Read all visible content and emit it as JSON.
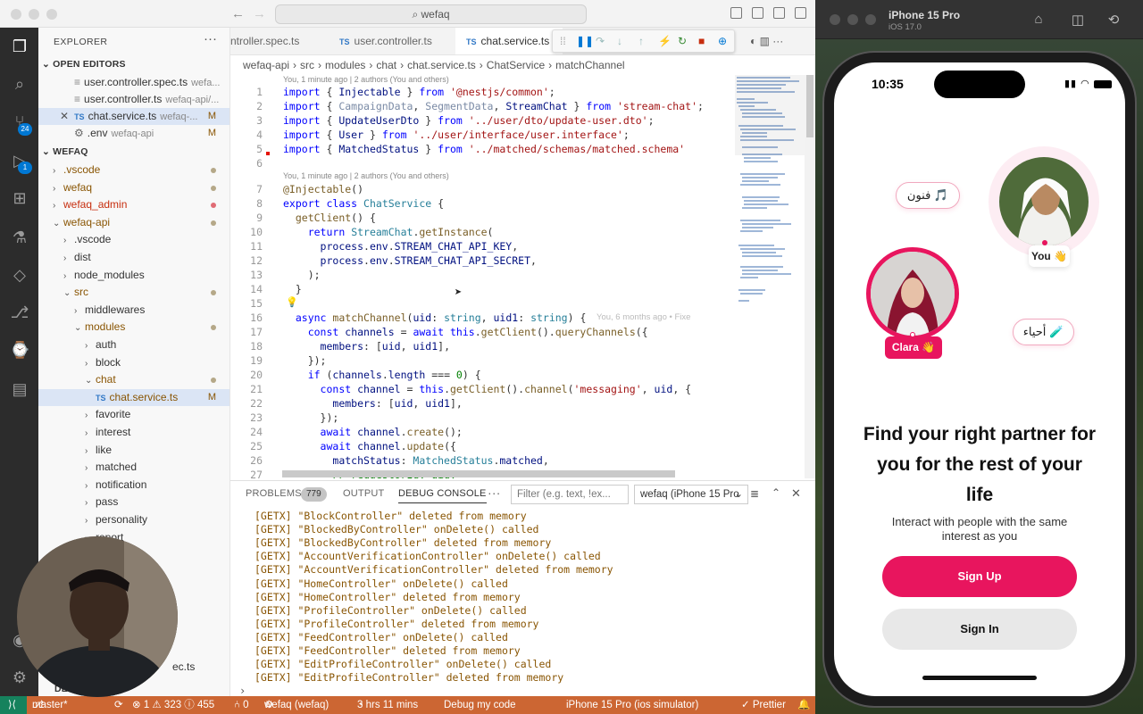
{
  "titlebar": {
    "search": "wefaq"
  },
  "activity": {
    "scm_badge": "24",
    "debug_badge": "1"
  },
  "explorer": {
    "title": "EXPLORER",
    "open_editors_label": "OPEN EDITORS",
    "open_editors": [
      {
        "name": "user.controller.spec.ts",
        "desc": "wefa...",
        "mod": ""
      },
      {
        "name": "user.controller.ts",
        "desc": "wefaq-api/...",
        "mod": ""
      },
      {
        "name": "chat.service.ts",
        "desc": "wefaq-...",
        "mod": "M"
      },
      {
        "name": ".env",
        "desc": "wefaq-api",
        "mod": "M"
      }
    ],
    "workspace_label": "WEFAQ",
    "tree": [
      {
        "name": ".vscode",
        "state": "›",
        "mod": "dot"
      },
      {
        "name": "wefaq",
        "state": "›",
        "mod": "dot"
      },
      {
        "name": "wefaq_admin",
        "state": "›",
        "mod": "red"
      },
      {
        "name": "wefaq-api",
        "state": "⌄",
        "mod": "dot"
      },
      {
        "name": ".vscode",
        "state": "›",
        "mod": ""
      },
      {
        "name": "dist",
        "state": "›",
        "mod": ""
      },
      {
        "name": "node_modules",
        "state": "›",
        "mod": ""
      },
      {
        "name": "src",
        "state": "⌄",
        "mod": "dot"
      },
      {
        "name": "middlewares",
        "state": "›",
        "mod": ""
      },
      {
        "name": "modules",
        "state": "⌄",
        "mod": "dot"
      },
      {
        "name": "auth",
        "state": "›",
        "mod": ""
      },
      {
        "name": "block",
        "state": "›",
        "mod": ""
      },
      {
        "name": "chat",
        "state": "⌄",
        "mod": "dot"
      },
      {
        "name": "chat.service.ts",
        "state": "TS",
        "mod": "M"
      },
      {
        "name": "favorite",
        "state": "›",
        "mod": ""
      },
      {
        "name": "interest",
        "state": "›",
        "mod": ""
      },
      {
        "name": "like",
        "state": "›",
        "mod": ""
      },
      {
        "name": "matched",
        "state": "›",
        "mod": ""
      },
      {
        "name": "notification",
        "state": "›",
        "mod": ""
      },
      {
        "name": "pass",
        "state": "›",
        "mod": ""
      },
      {
        "name": "personality",
        "state": "›",
        "mod": ""
      },
      {
        "name": "report",
        "state": "›",
        "mod": ""
      }
    ],
    "hidden_row": "ec.ts",
    "bottom_label": "DE"
  },
  "tabs": [
    {
      "label": "ntroller.spec.ts",
      "icon": ""
    },
    {
      "label": "user.controller.ts",
      "icon": "TS"
    },
    {
      "label": "chat.service.ts",
      "icon": "TS"
    }
  ],
  "breadcrumb": [
    "wefaq-api",
    "›",
    "src",
    "›",
    "modules",
    "›",
    "chat",
    "›",
    "chat.service.ts",
    "›",
    "ChatService",
    "›",
    "matchChannel"
  ],
  "blame": {
    "top": "You, 1 minute ago | 2 authors (You and others)",
    "mid": "You, 1 minute ago | 2 authors (You and others)",
    "inline": "You, 6 months ago • Fixe"
  },
  "code_lines": [
    {
      "n": "1",
      "html": "<span class='kw'>import</span> { <span class='vr'>Injectable</span> } <span class='kw'>from</span> <span class='st'>'@nestjs/common'</span>;"
    },
    {
      "n": "2",
      "html": "<span class='kw'>import</span> { <span class='vr' style='color:#7a8aa5'>CampaignData</span>, <span class='vr' style='color:#7a8aa5'>SegmentData</span>, <span class='vr'>StreamChat</span> } <span class='kw'>from</span> <span class='st'>'stream-chat'</span>;"
    },
    {
      "n": "3",
      "html": "<span class='kw'>import</span> { <span class='vr'>UpdateUserDto</span> } <span class='kw'>from</span> <span class='st'>'../user/dto/update-user.dto'</span>;"
    },
    {
      "n": "4",
      "html": "<span class='kw'>import</span> { <span class='vr'>User</span> } <span class='kw'>from</span> <span class='st'>'../user/interface/user.interface'</span>;"
    },
    {
      "n": "5",
      "html": "<span class='kw'>import</span> { <span class='vr'>MatchedStatus</span> } <span class='kw'>from</span> <span class='st'>'../matched/schemas/matched.schema'</span>"
    },
    {
      "n": "6",
      "html": ""
    },
    {
      "n": "7",
      "html": "<span class='dec'>@Injectable</span>()"
    },
    {
      "n": "8",
      "html": "<span class='kw'>export</span> <span class='kw'>class</span> <span class='ty'>ChatService</span> {"
    },
    {
      "n": "9",
      "html": "  <span class='fn'>getClient</span>() {"
    },
    {
      "n": "10",
      "html": "    <span class='kw'>return</span> <span class='ty'>StreamChat</span>.<span class='fn'>getInstance</span>("
    },
    {
      "n": "11",
      "html": "      <span class='vr'>process</span>.<span class='vr'>env</span>.<span class='vr'>STREAM_CHAT_API_KEY</span>,"
    },
    {
      "n": "12",
      "html": "      <span class='vr'>process</span>.<span class='vr'>env</span>.<span class='vr'>STREAM_CHAT_API_SECRET</span>,"
    },
    {
      "n": "13",
      "html": "    );"
    },
    {
      "n": "14",
      "html": "  }"
    },
    {
      "n": "15",
      "html": ""
    },
    {
      "n": "16",
      "html": "  <span class='kw'>async</span> <span class='fn'>matchChannel</span>(<span class='vr'>uid</span>: <span class='ty'>string</span>, <span class='vr'>uid1</span>: <span class='ty'>string</span>) {"
    },
    {
      "n": "17",
      "html": "    <span class='kw'>const</span> <span class='vr'>channels</span> = <span class='kw'>await</span> <span class='kw'>this</span>.<span class='fn'>getClient</span>().<span class='fn'>queryChannels</span>({"
    },
    {
      "n": "18",
      "html": "      <span class='vr'>members</span>: [<span class='vr'>uid</span>, <span class='vr'>uid1</span>],"
    },
    {
      "n": "19",
      "html": "    });"
    },
    {
      "n": "20",
      "html": "    <span class='kw'>if</span> (<span class='vr'>channels</span>.<span class='vr'>length</span> === <span class='cm'>0</span>) {"
    },
    {
      "n": "21",
      "html": "      <span class='kw'>const</span> <span class='vr'>channel</span> = <span class='kw'>this</span>.<span class='fn'>getClient</span>().<span class='fn'>channel</span>(<span class='st'>'messaging'</span>, <span class='vr'>uid</span>, {"
    },
    {
      "n": "22",
      "html": "        <span class='vr'>members</span>: [<span class='vr'>uid</span>, <span class='vr'>uid1</span>],"
    },
    {
      "n": "23",
      "html": "      });"
    },
    {
      "n": "24",
      "html": "      <span class='kw'>await</span> <span class='vr'>channel</span>.<span class='fn'>create</span>();"
    },
    {
      "n": "25",
      "html": "      <span class='kw'>await</span> <span class='vr'>channel</span>.<span class='fn'>update</span>({"
    },
    {
      "n": "26",
      "html": "        <span class='vr'>matchStatus</span>: <span class='ty'>MatchedStatus</span>.<span class='vr'>matched</span>,"
    },
    {
      "n": "27",
      "html": "        <span class='cm'>// requestorId: uid,</span>"
    }
  ],
  "panel": {
    "tabs": [
      "PROBLEMS",
      "OUTPUT",
      "DEBUG CONSOLE"
    ],
    "problems_count": "779",
    "more": "···",
    "filter_placeholder": "Filter (e.g. text, !ex...",
    "session": "wefaq (iPhone 15 Pro",
    "prompt": "›",
    "logs": [
      "[GETX] \"BlockController\" deleted from memory",
      "[GETX] \"BlockedByController\" onDelete() called",
      "[GETX] \"BlockedByController\" deleted from memory",
      "[GETX] \"AccountVerificationController\" onDelete() called",
      "[GETX] \"AccountVerificationController\" deleted from memory",
      "[GETX] \"HomeController\" onDelete() called",
      "[GETX] \"HomeController\" deleted from memory",
      "[GETX] \"ProfileController\" onDelete() called",
      "[GETX] \"ProfileController\" deleted from memory",
      "[GETX] \"FeedController\" onDelete() called",
      "[GETX] \"FeedController\" deleted from memory",
      "[GETX] \"EditProfileController\" onDelete() called",
      "[GETX] \"EditProfileController\" deleted from memory"
    ]
  },
  "status": {
    "branch": "master*",
    "sync": "⟳",
    "errors": "⊗ 1 ⚠ 323 ⓘ 455",
    "ports": "⑃ 0",
    "debug_target": "wefaq (wefaq)",
    "time": "3 hrs 11 mins",
    "debug_my_code": "Debug my code",
    "device": "iPhone 15 Pro (ios simulator)",
    "prettier": "✓ Prettier",
    "bell": "🔔"
  },
  "simulator": {
    "title": "iPhone 15 Pro",
    "subtitle": "iOS 17.0",
    "time": "10:35",
    "chip_arts": "فنون 🎵",
    "chip_bio": "أحياء 🧪",
    "tag_you": "You 👋",
    "tag_clara": "Clara 👋",
    "headline": "Find your right partner for you for the rest of your life",
    "subline": "Interact with people with the same interest as you",
    "signup": "Sign Up",
    "signin": "Sign In",
    "accent": "#e8155e"
  }
}
